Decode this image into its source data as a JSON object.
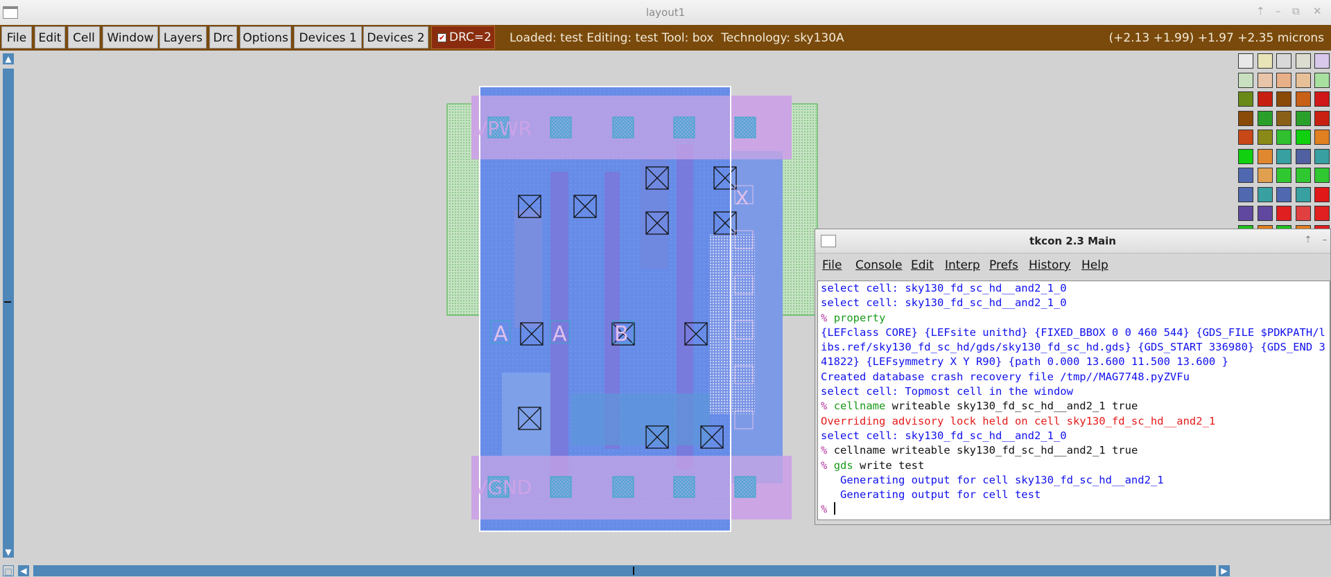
{
  "window": {
    "title": "layout1"
  },
  "menu": {
    "items": [
      "File",
      "Edit",
      "Cell",
      "Window",
      "Layers",
      "Drc",
      "Options",
      "Devices 1",
      "Devices 2"
    ],
    "drc_label": "DRC=2",
    "status": "Loaded: test Editing: test Tool: box  Technology: sky130A",
    "coords": "(+2.13 +1.99) +1.97 +2.35 microns"
  },
  "layout": {
    "labels": {
      "vpwr": "VPWR",
      "vgnd": "VGND",
      "a1": "A",
      "a2": "A",
      "b": "B",
      "x": "X"
    }
  },
  "tkcon": {
    "title": "tkcon 2.3 Main",
    "menu": [
      "File",
      "Console",
      "Edit",
      "Interp",
      "Prefs",
      "History",
      "Help"
    ],
    "prompt": "%",
    "lines": [
      {
        "cls": "blue",
        "prompt": false,
        "cmd": "",
        "text": "select cell: sky130_fd_sc_hd__and2_1_0"
      },
      {
        "cls": "blue",
        "prompt": false,
        "cmd": "",
        "text": "select cell: sky130_fd_sc_hd__and2_1_0"
      },
      {
        "cls": "green",
        "prompt": true,
        "cmd": "property",
        "text": ""
      },
      {
        "cls": "blue",
        "prompt": false,
        "cmd": "",
        "text": "{LEFclass CORE} {LEFsite unithd} {FIXED_BBOX 0 0 460 544} {GDS_FILE $PDKPATH/l"
      },
      {
        "cls": "blue",
        "prompt": false,
        "cmd": "",
        "text": "ibs.ref/sky130_fd_sc_hd/gds/sky130_fd_sc_hd.gds} {GDS_START 336980} {GDS_END 3"
      },
      {
        "cls": "blue",
        "prompt": false,
        "cmd": "",
        "text": "41822} {LEFsymmetry X Y R90} {path 0.000 13.600 11.500 13.600 }"
      },
      {
        "cls": "blue",
        "prompt": false,
        "cmd": "",
        "text": "Created database crash recovery file /tmp//MAG7748.pyZVFu"
      },
      {
        "cls": "blue",
        "prompt": false,
        "cmd": "",
        "text": "select cell: Topmost cell in the window"
      },
      {
        "cls": "green",
        "prompt": true,
        "cmd": "cellname",
        "text": " writeable sky130_fd_sc_hd__and2_1 true"
      },
      {
        "cls": "red",
        "prompt": false,
        "cmd": "",
        "text": "Overriding advisory lock held on cell sky130_fd_sc_hd__and2_1"
      },
      {
        "cls": "blue",
        "prompt": false,
        "cmd": "",
        "text": "select cell: sky130_fd_sc_hd__and2_1_0"
      },
      {
        "cls": "black",
        "prompt": true,
        "cmd": "cellname",
        "text": " writeable sky130_fd_sc_hd__and2_1 true"
      },
      {
        "cls": "green",
        "prompt": true,
        "cmd": "gds",
        "text": " write test"
      },
      {
        "cls": "blue",
        "prompt": false,
        "cmd": "",
        "text": "   Generating output for cell sky130_fd_sc_hd__and2_1"
      },
      {
        "cls": "blue",
        "prompt": false,
        "cmd": "",
        "text": "   Generating output for cell test"
      }
    ]
  }
}
